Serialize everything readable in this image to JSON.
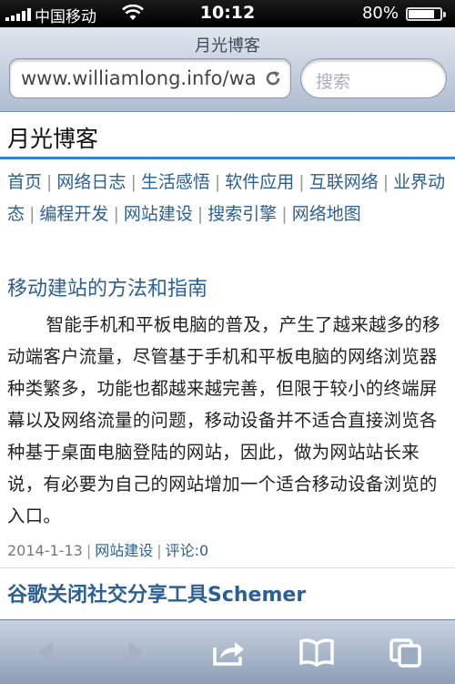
{
  "status": {
    "carrier": "中国移动",
    "time": "10:12",
    "battery": "80%"
  },
  "browser": {
    "page_title": "月光博客",
    "url": "www.williamlong.info/wa",
    "search_placeholder": "搜索"
  },
  "site": {
    "title": "月光博客",
    "nav": [
      "首页",
      "网络日志",
      "生活感悟",
      "软件应用",
      "互联网络",
      "业界动态",
      "编程开发",
      "网站建设",
      "搜索引擎",
      "网络地图"
    ]
  },
  "article": {
    "title": "移动建站的方法和指南",
    "body": "智能手机和平板电脑的普及，产生了越来越多的移动端客户流量，尽管基于手机和平板电脑的网络浏览器种类繁多，功能也都越来越完善，但限于较小的终端屏幕以及网络流量的问题，移动设备并不适合直接浏览各种基于桌面电脑登陆的网站，因此，做为网站站长来说，有必要为自己的网站增加一个适合移动设备浏览的入口。",
    "date": "2014-1-13",
    "category": "网站建设",
    "comments": "评论:0"
  },
  "next_article": {
    "title": "谷歌关闭社交分享工具Schemer"
  }
}
